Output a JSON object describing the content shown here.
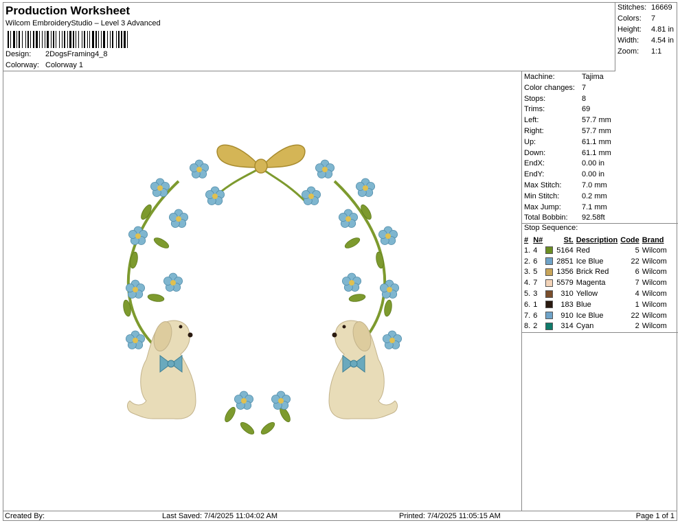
{
  "header": {
    "title": "Production Worksheet",
    "subtitle": "Wilcom EmbroideryStudio – Level 3 Advanced",
    "design_label": "Design:",
    "design_value": "2DogsFraming4_8",
    "colorway_label": "Colorway:",
    "colorway_value": "Colorway 1"
  },
  "stats": [
    {
      "label": "Stitches:",
      "value": "16669"
    },
    {
      "label": "Colors:",
      "value": "7"
    },
    {
      "label": "Height:",
      "value": "4.81 in"
    },
    {
      "label": "Width:",
      "value": "4.54 in"
    },
    {
      "label": "Zoom:",
      "value": "1:1"
    }
  ],
  "machine_info": [
    {
      "label": "Machine:",
      "value": "Tajima"
    },
    {
      "label": "Color changes:",
      "value": "7"
    },
    {
      "label": "Stops:",
      "value": "8"
    },
    {
      "label": "Trims:",
      "value": "69"
    },
    {
      "label": "Left:",
      "value": "57.7 mm"
    },
    {
      "label": "Right:",
      "value": "57.7 mm"
    },
    {
      "label": "Up:",
      "value": "61.1 mm"
    },
    {
      "label": "Down:",
      "value": "61.1 mm"
    },
    {
      "label": "EndX:",
      "value": "0.00 in"
    },
    {
      "label": "EndY:",
      "value": "0.00 in"
    },
    {
      "label": "Max Stitch:",
      "value": "7.0 mm"
    },
    {
      "label": "Min Stitch:",
      "value": "0.2 mm"
    },
    {
      "label": "Max Jump:",
      "value": "7.1 mm"
    },
    {
      "label": "Total Bobbin:",
      "value": "92.58ft"
    }
  ],
  "stop_sequence": {
    "title": "Stop Sequence:",
    "columns": [
      "#",
      "N#",
      "St.",
      "Description",
      "Code",
      "Brand"
    ],
    "rows": [
      {
        "num": "1.",
        "n": "4",
        "color": "#6b8e23",
        "st": "5164",
        "desc": "Red",
        "code": "5",
        "brand": "Wilcom"
      },
      {
        "num": "2.",
        "n": "6",
        "color": "#6fa3c8",
        "st": "2851",
        "desc": "Ice Blue",
        "code": "22",
        "brand": "Wilcom"
      },
      {
        "num": "3.",
        "n": "5",
        "color": "#c8a55a",
        "st": "1356",
        "desc": "Brick Red",
        "code": "6",
        "brand": "Wilcom"
      },
      {
        "num": "4.",
        "n": "7",
        "color": "#f2d3b8",
        "st": "5579",
        "desc": "Magenta",
        "code": "7",
        "brand": "Wilcom"
      },
      {
        "num": "5.",
        "n": "3",
        "color": "#7a4e2c",
        "st": "310",
        "desc": "Yellow",
        "code": "4",
        "brand": "Wilcom"
      },
      {
        "num": "6.",
        "n": "1",
        "color": "#2a1a10",
        "st": "183",
        "desc": "Blue",
        "code": "1",
        "brand": "Wilcom"
      },
      {
        "num": "7.",
        "n": "6",
        "color": "#6fa3c8",
        "st": "910",
        "desc": "Ice Blue",
        "code": "22",
        "brand": "Wilcom"
      },
      {
        "num": "8.",
        "n": "2",
        "color": "#0f7a6a",
        "st": "314",
        "desc": "Cyan",
        "code": "2",
        "brand": "Wilcom"
      }
    ]
  },
  "footer": {
    "created_by": "Created By:",
    "last_saved": "Last Saved: 7/4/2025 11:04:02 AM",
    "printed": "Printed: 7/4/2025 11:05:15 AM",
    "page": "Page 1 of 1"
  },
  "colors": {
    "leaf": "#7d9a2e",
    "flower": "#7fb6cf",
    "flower_center": "#e0c050",
    "bow": "#d4b556",
    "dog": "#e8dcb8",
    "dog_bow": "#6aa9bd"
  }
}
